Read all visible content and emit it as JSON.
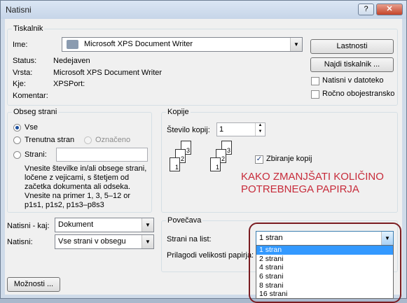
{
  "window": {
    "title": "Natisni",
    "help_label": "?",
    "close_label": "✕"
  },
  "printer": {
    "group_label": "Tiskalnik",
    "name_label": "Ime:",
    "name_value": "Microsoft XPS Document Writer",
    "status_label": "Status:",
    "status_value": "Nedejaven",
    "type_label": "Vrsta:",
    "type_value": "Microsoft XPS Document Writer",
    "where_label": "Kje:",
    "where_value": "XPSPort:",
    "comment_label": "Komentar:",
    "comment_value": "",
    "properties_button": "Lastnosti",
    "find_button": "Najdi tiskalnik ...",
    "print_to_file": "Natisni v datoteko",
    "manual_duplex": "Ročno obojestransko"
  },
  "range": {
    "group_label": "Obseg strani",
    "all": "Vse",
    "current": "Trenutna stran",
    "selection": "Označeno",
    "pages": "Strani:",
    "pages_value": "",
    "hint": "Vnesite številke in/ali obsege strani, ločene z vejicami, s štetjem od začetka dokumenta ali odseka. Vnesite na primer 1, 3, 5–12 or p1s1, p1s2, p1s3–p8s3"
  },
  "copies": {
    "group_label": "Kopije",
    "count_label": "Število kopij:",
    "count_value": "1",
    "collate_label": "Zbiranje kopij",
    "page_numbers": [
      "1",
      "2",
      "3"
    ]
  },
  "print_what": {
    "label": "Natisni - kaj:",
    "value": "Dokument"
  },
  "print_which": {
    "label": "Natisni:",
    "value": "Vse strani v obsegu"
  },
  "zoom": {
    "group_label": "Povečava",
    "pages_per_sheet_label": "Strani na list:",
    "pages_per_sheet_value": "1 stran",
    "scale_label": "Prilagodi velikosti papirja:",
    "options": [
      "1 stran",
      "2 strani",
      "4 strani",
      "6 strani",
      "8 strani",
      "16 strani"
    ],
    "selected_option": "1 stran"
  },
  "annotation": {
    "text": "KAKO ZMANJŠATI KOLIČINO POTREBNEGA PAPIRJA",
    "color": "#c72b3a"
  },
  "buttons": {
    "options": "Možnosti ..."
  },
  "colors": {
    "accent": "#3399ff",
    "highlight_box": "#7a1c21"
  }
}
